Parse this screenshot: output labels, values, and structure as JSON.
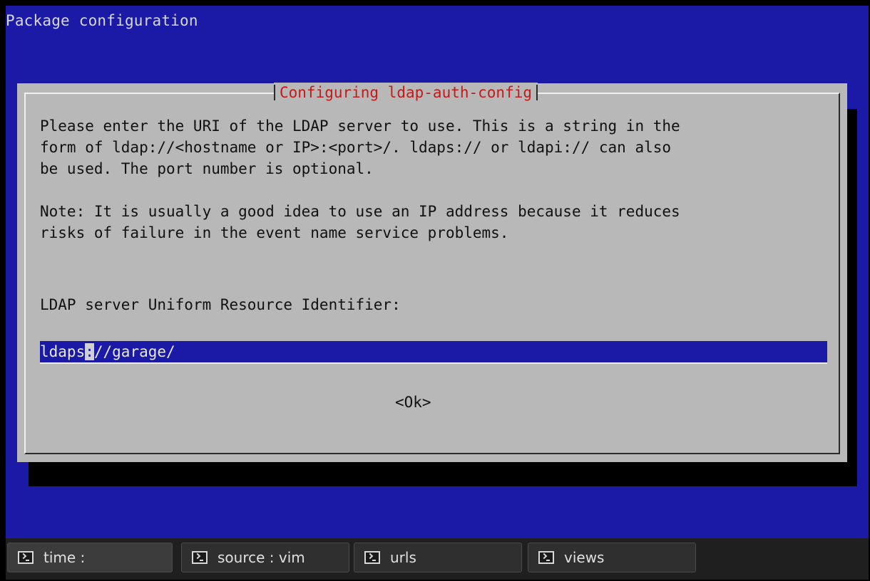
{
  "screen": {
    "background_title": "Package configuration",
    "colors": {
      "background": "#1a1aa6",
      "dialog": "#b8b8b8",
      "title": "#c41a1a"
    }
  },
  "dialog": {
    "title": "Configuring ldap-auth-config",
    "message_lines": [
      "Please enter the URI of the LDAP server to use. This is a string in the",
      "form of ldap://<hostname or IP>:<port>/. ldaps:// or ldapi:// can also",
      "be used. The port number is optional.",
      "",
      "Note: It is usually a good idea to use an IP address because it reduces",
      "risks of failure in the event name service problems."
    ],
    "field_label": "LDAP server Uniform Resource Identifier:",
    "input": {
      "before_cursor": "ldaps",
      "cursor_char": ":",
      "after_cursor": "//garage/"
    },
    "ok_label": "<Ok>"
  },
  "taskbar": {
    "tasks": [
      {
        "label": "time :",
        "icon": "terminal-icon"
      },
      {
        "label": "source : vim",
        "icon": "terminal-icon"
      },
      {
        "label": "urls",
        "icon": "terminal-icon"
      },
      {
        "label": "views",
        "icon": "terminal-icon"
      }
    ]
  }
}
